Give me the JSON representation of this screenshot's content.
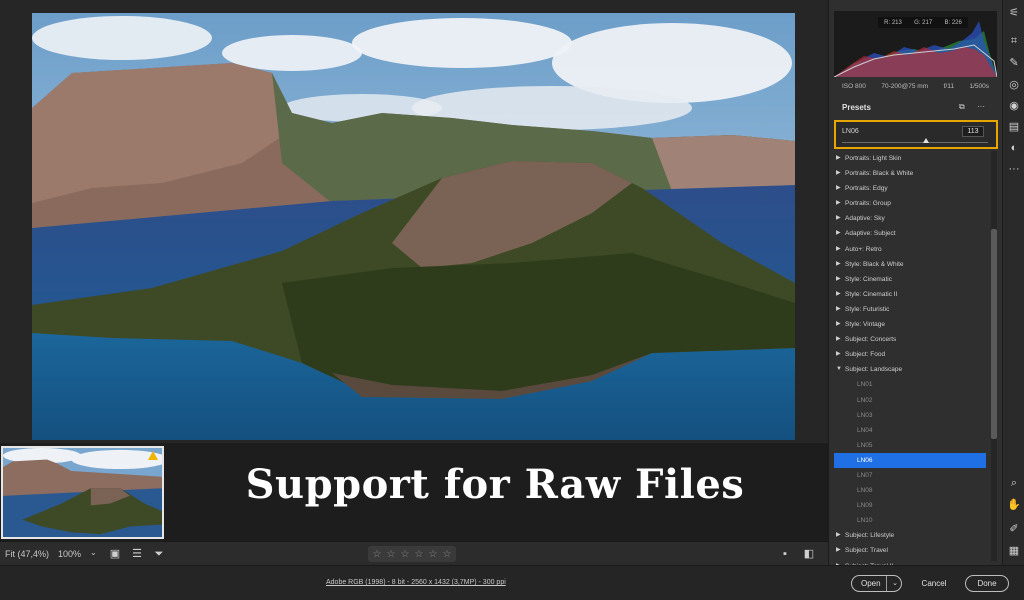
{
  "caption": "Support for Raw Files",
  "toolbar": {
    "fit_label": "Fit (47,4%)",
    "zoom_label": "100%",
    "zoom_caret": "⌄",
    "stars": [
      "☆",
      "☆",
      "☆",
      "☆",
      "☆",
      "☆"
    ]
  },
  "status": {
    "info_link": "Adobe RGB (1998) - 8 bit - 2560 x 1432 (3,7MP) - 300 ppi",
    "open_label": "Open",
    "open_caret": "⌄",
    "cancel_label": "Cancel",
    "done_label": "Done"
  },
  "histogram": {
    "r": "R: 213",
    "g": "G: 217",
    "b": "B: 226",
    "iso": "ISO 800",
    "lens": "70-200@75 mm",
    "aperture": "f/11",
    "shutter": "1/500s"
  },
  "presets": {
    "title": "Presets",
    "amount_name": "LN06",
    "amount_value": "113",
    "amount_level": 0.56,
    "items": [
      {
        "label": "Portraits: Light Skin",
        "type": "group",
        "arrow": "▶"
      },
      {
        "label": "Portraits: Black & White",
        "type": "group",
        "arrow": "▶"
      },
      {
        "label": "Portraits: Edgy",
        "type": "group",
        "arrow": "▶"
      },
      {
        "label": "Portraits: Group",
        "type": "group",
        "arrow": "▶"
      },
      {
        "label": "Adaptive: Sky",
        "type": "group",
        "arrow": "▶"
      },
      {
        "label": "Adaptive: Subject",
        "type": "group",
        "arrow": "▶"
      },
      {
        "label": "Auto+: Retro",
        "type": "group",
        "arrow": "▶"
      },
      {
        "label": "Style: Black & White",
        "type": "group",
        "arrow": "▶"
      },
      {
        "label": "Style: Cinematic",
        "type": "group",
        "arrow": "▶"
      },
      {
        "label": "Style: Cinematic II",
        "type": "group",
        "arrow": "▶"
      },
      {
        "label": "Style: Futuristic",
        "type": "group",
        "arrow": "▶"
      },
      {
        "label": "Style: Vintage",
        "type": "group",
        "arrow": "▶"
      },
      {
        "label": "Subject: Concerts",
        "type": "group",
        "arrow": "▶"
      },
      {
        "label": "Subject: Food",
        "type": "group",
        "arrow": "▶"
      },
      {
        "label": "Subject: Landscape",
        "type": "group-open",
        "arrow": "▼"
      },
      {
        "label": "LN01",
        "type": "child",
        "arrow": ""
      },
      {
        "label": "LN02",
        "type": "child",
        "arrow": ""
      },
      {
        "label": "LN03",
        "type": "child",
        "arrow": ""
      },
      {
        "label": "LN04",
        "type": "child",
        "arrow": ""
      },
      {
        "label": "LN05",
        "type": "child",
        "arrow": ""
      },
      {
        "label": "LN06",
        "type": "selected",
        "arrow": ""
      },
      {
        "label": "LN07",
        "type": "child",
        "arrow": ""
      },
      {
        "label": "LN08",
        "type": "child",
        "arrow": ""
      },
      {
        "label": "LN09",
        "type": "child",
        "arrow": ""
      },
      {
        "label": "LN10",
        "type": "child",
        "arrow": ""
      },
      {
        "label": "Subject: Lifestyle",
        "type": "group",
        "arrow": "▶"
      },
      {
        "label": "Subject: Travel",
        "type": "group",
        "arrow": "▶"
      },
      {
        "label": "Subject: Travel II",
        "type": "group",
        "arrow": "▶"
      }
    ]
  },
  "colors": {
    "accent_highlight": "#e7a600",
    "selected_row": "#1f6fe5",
    "warning": "#f0b400"
  },
  "icons": {
    "tools": [
      "edit-icon",
      "crop-icon",
      "heal-icon",
      "mask-icon",
      "redeye-icon",
      "snapshots-icon",
      "presets-icon",
      "more-icon",
      "zoom-icon",
      "hand-icon",
      "sampler-icon",
      "grid-icon"
    ]
  }
}
